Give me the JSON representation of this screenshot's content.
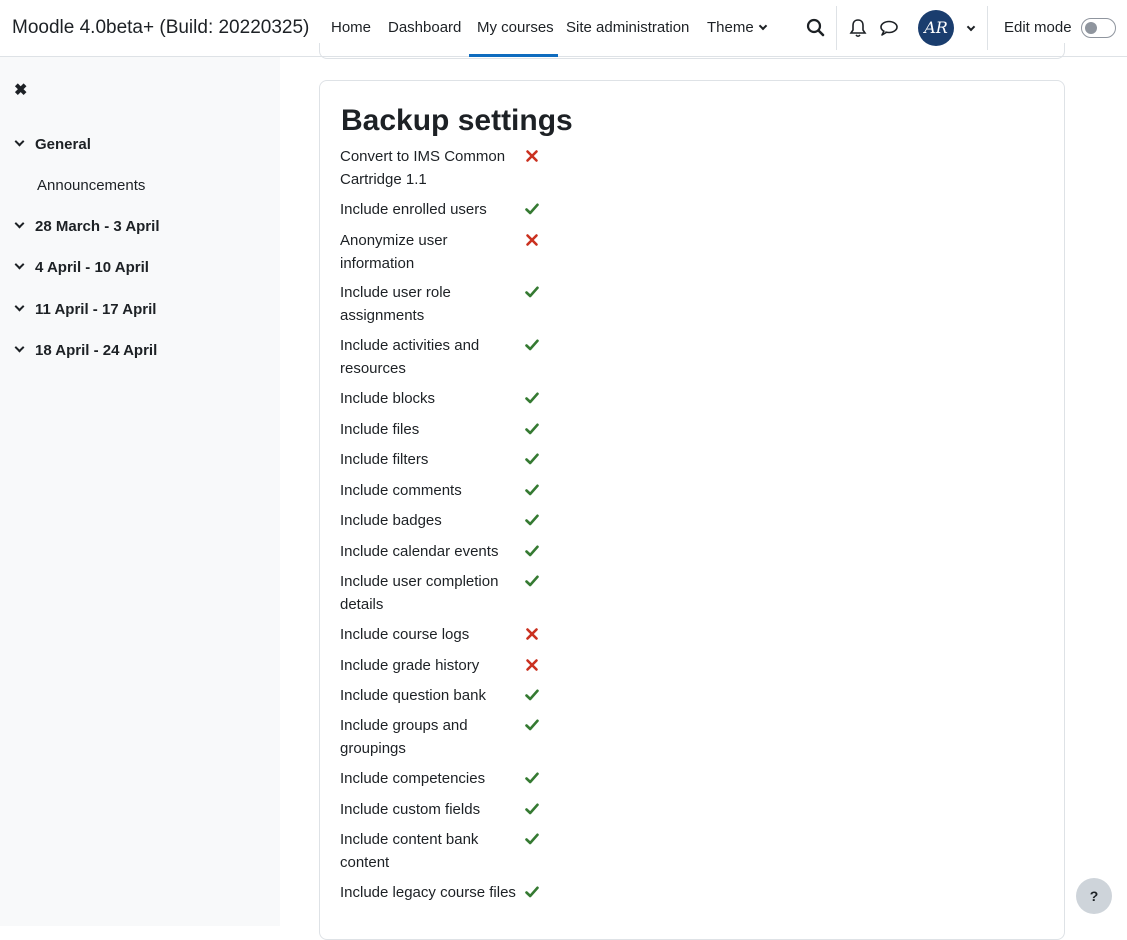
{
  "navbar": {
    "site_name": "Moodle 4.0beta+ (Build: 20220325)",
    "links": [
      "Home",
      "Dashboard",
      "My courses",
      "Site administration",
      "Theme"
    ],
    "active_link": "My courses",
    "avatar_initials": "AR",
    "edit_mode_label": "Edit mode",
    "edit_mode_on": false
  },
  "drawer": {
    "sections": [
      {
        "title": "General",
        "items": [
          "Announcements"
        ]
      },
      {
        "title": "28 March - 3 April",
        "items": []
      },
      {
        "title": "4 April - 10 April",
        "items": []
      },
      {
        "title": "11 April - 17 April",
        "items": []
      },
      {
        "title": "18 April - 24 April",
        "items": []
      }
    ]
  },
  "main": {
    "heading": "Backup settings",
    "settings": [
      {
        "label": "Convert to IMS Common Cartridge 1.1",
        "enabled": false
      },
      {
        "label": "Include enrolled users",
        "enabled": true
      },
      {
        "label": "Anonymize user information",
        "enabled": false
      },
      {
        "label": "Include user role assignments",
        "enabled": true
      },
      {
        "label": "Include activities and resources",
        "enabled": true
      },
      {
        "label": "Include blocks",
        "enabled": true
      },
      {
        "label": "Include files",
        "enabled": true
      },
      {
        "label": "Include filters",
        "enabled": true
      },
      {
        "label": "Include comments",
        "enabled": true
      },
      {
        "label": "Include badges",
        "enabled": true
      },
      {
        "label": "Include calendar events",
        "enabled": true
      },
      {
        "label": "Include user completion details",
        "enabled": true
      },
      {
        "label": "Include course logs",
        "enabled": false
      },
      {
        "label": "Include grade history",
        "enabled": false
      },
      {
        "label": "Include question bank",
        "enabled": true
      },
      {
        "label": "Include groups and groupings",
        "enabled": true
      },
      {
        "label": "Include competencies",
        "enabled": true
      },
      {
        "label": "Include custom fields",
        "enabled": true
      },
      {
        "label": "Include content bank content",
        "enabled": true
      },
      {
        "label": "Include legacy course files",
        "enabled": true
      }
    ]
  },
  "help_button_label": "?",
  "colors": {
    "accent": "#0f6cbf",
    "check": "#357a32",
    "cross": "#ca3120"
  }
}
